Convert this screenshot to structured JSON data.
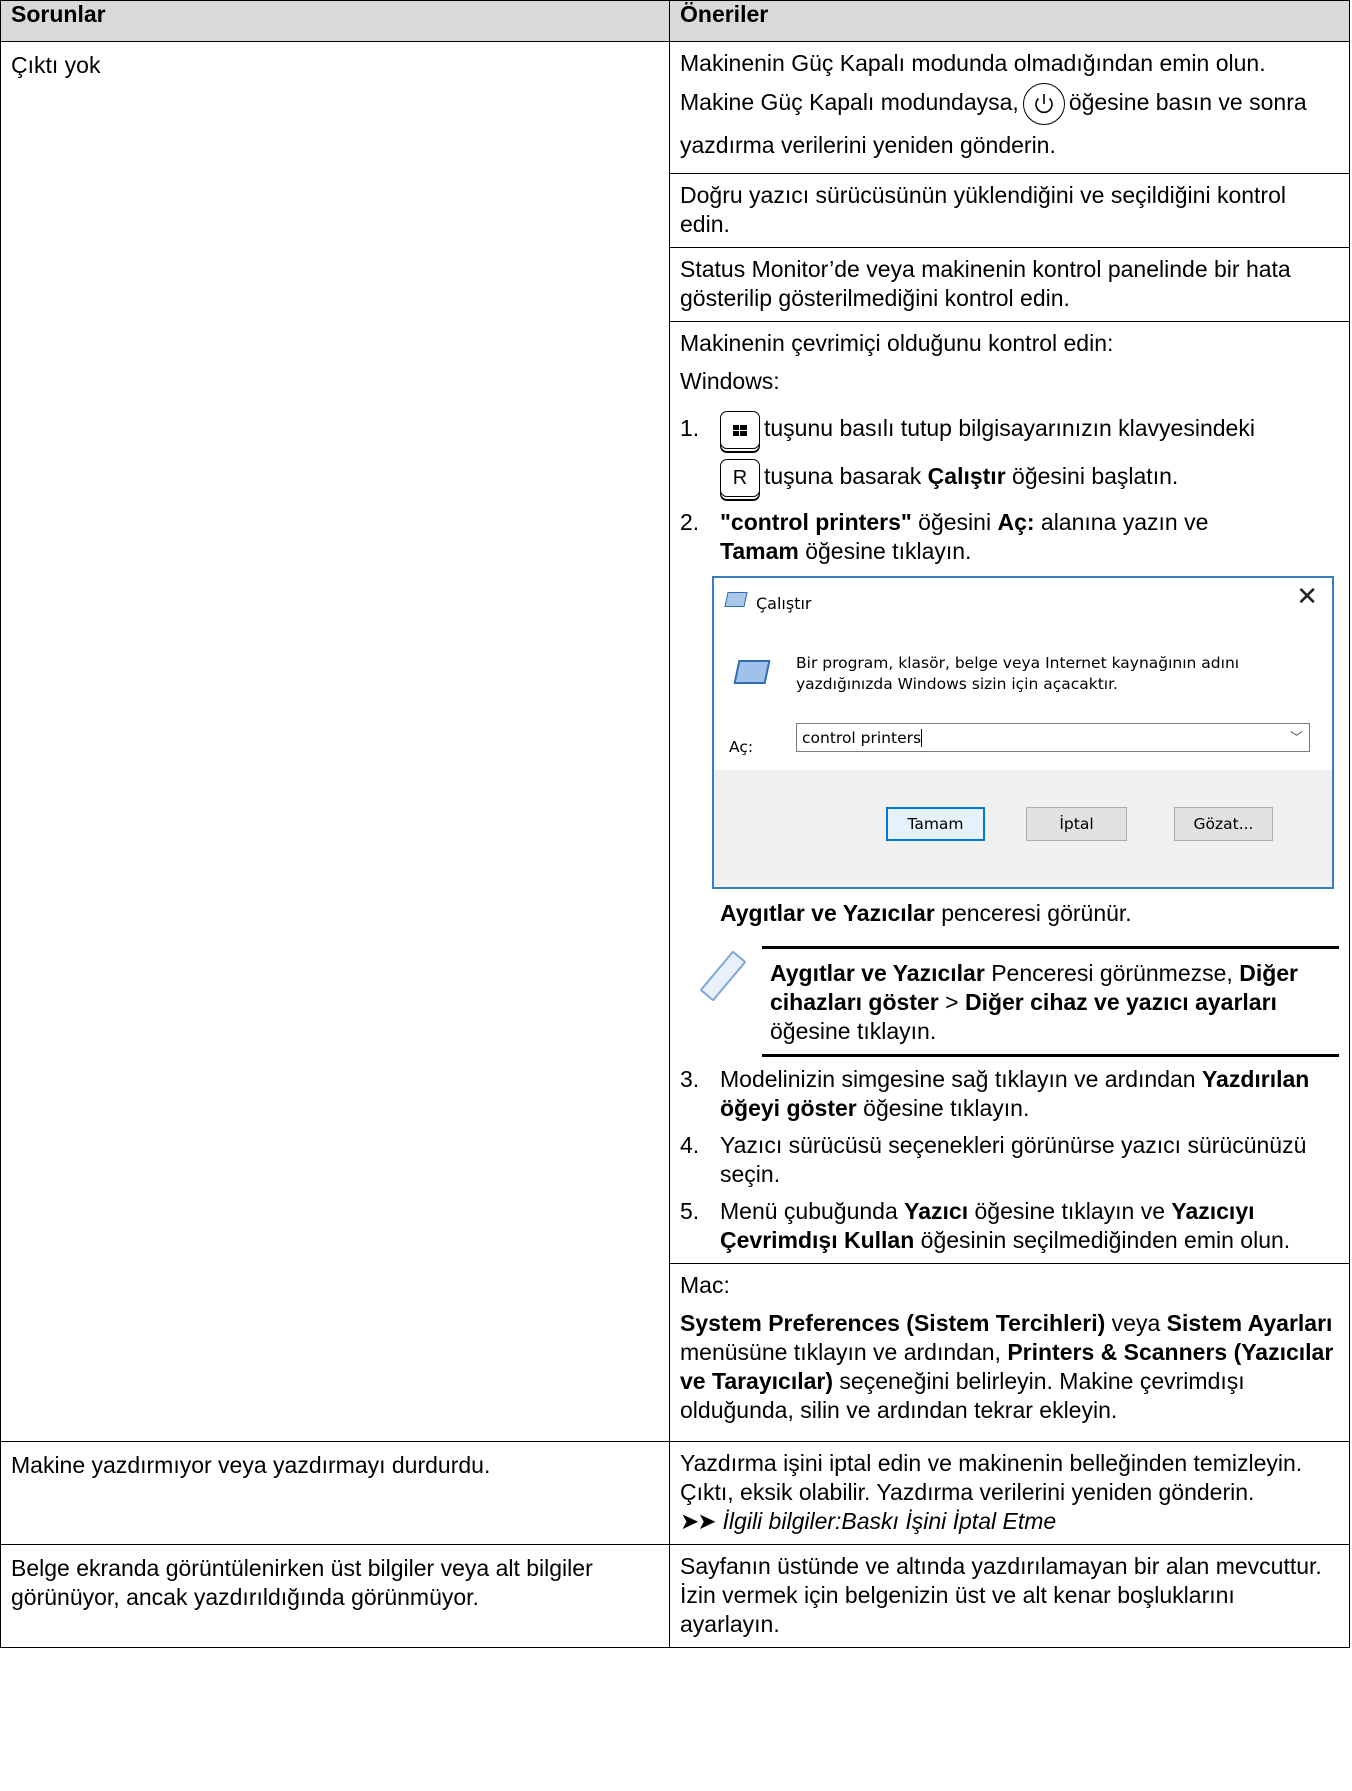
{
  "header": {
    "col_problems": "Sorunlar",
    "col_suggestions": "Öneriler"
  },
  "row1": {
    "problem": "Çıktı yok",
    "s1": "Makinenin Güç Kapalı modunda olmadığından emin olun.",
    "s2_a": "Makine Güç Kapalı modundaysa,",
    "s2_b": "öğesine basın ve sonra yazdırma verilerini yeniden gönderin.",
    "s3": "Doğru yazıcı sürücüsünün yüklendiğini ve seçildiğini kontrol edin.",
    "s4": "Status Monitor’de veya makinenin kontrol panelinde bir hata gösterilip gösterilmediğini kontrol edin.",
    "s5_intro": "Makinenin çevrimiçi olduğunu kontrol edin:",
    "s5_os": "Windows:",
    "step1_num": "1.",
    "step1_a": "tuşunu basılı tutup bilgisayarınızın klavyesindeki",
    "step1_key_r": "R",
    "step1_b": "tuşuna basarak",
    "step1_bold": "Çalıştır",
    "step1_c": "öğesini başlatın.",
    "step2_num": "2.",
    "step2_bold1": "\"control printers\"",
    "step2_a": "öğesini",
    "step2_bold2": "Aç:",
    "step2_b": "alanına yazın ve",
    "step2_bold3": "Tamam",
    "step2_c": "öğesine tıklayın.",
    "dialog": {
      "title": "Çalıştır",
      "desc_line1": "Bir program, klasör, belge veya Internet kaynağının adını",
      "desc_line2": "yazdığınızda Windows sizin için açacaktır.",
      "open_label": "Aç:",
      "input_value": "control printers",
      "ok": "Tamam",
      "cancel": "İptal",
      "browse": "Gözat..."
    },
    "after_dialog_bold": "Aygıtlar ve Yazıcılar",
    "after_dialog": "penceresi görünür.",
    "note_bold1": "Aygıtlar ve Yazıcılar",
    "note_a": "Penceresi görünmezse,",
    "note_bold2": "Diğer cihazları göster",
    "note_sep": ">",
    "note_bold3": "Diğer cihaz ve yazıcı ayarları",
    "note_b": "öğesine tıklayın.",
    "step3_num": "3.",
    "step3_a": "Modelinizin simgesine sağ tıklayın ve ardından",
    "step3_bold": "Yazdırılan öğeyi göster",
    "step3_b": "öğesine tıklayın.",
    "step4_num": "4.",
    "step4": "Yazıcı sürücüsü seçenekleri görünürse yazıcı sürücünüzü seçin.",
    "step5_num": "5.",
    "step5_a": "Menü çubuğunda",
    "step5_bold1": "Yazıcı",
    "step5_b": "öğesine tıklayın ve",
    "step5_bold2": "Yazıcıyı Çevrimdışı Kullan",
    "step5_c": "öğesinin seçilmediğinden emin olun.",
    "mac_label": "Mac:",
    "mac_bold1": "System Preferences (Sistem Tercihleri)",
    "mac_a": "veya",
    "mac_bold2": "Sistem Ayarları",
    "mac_b": "menüsüne tıklayın ve ardından,",
    "mac_bold3": "Printers & Scanners (Yazıcılar ve Tarayıcılar)",
    "mac_c": "seçeneğini belirleyin. Makine çevrimdışı olduğunda, silin ve ardından tekrar ekleyin."
  },
  "row2": {
    "problem": "Makine yazdırmıyor veya yazdırmayı durdurdu.",
    "suggestion": "Yazdırma işini iptal edin ve makinenin belleğinden temizleyin. Çıktı, eksik olabilir. Yazdırma verilerini yeniden gönderin.",
    "related_arrows": "➤➤",
    "related": "İlgili bilgiler:Baskı İşini İptal Etme"
  },
  "row3": {
    "problem": "Belge ekranda görüntülenirken üst bilgiler veya alt bilgiler görünüyor, ancak yazdırıldığında görünmüyor.",
    "suggestion": "Sayfanın üstünde ve altında yazdırılamayan bir alan mevcuttur. İzin vermek için belgenizin üst ve alt kenar boşluklarını ayarlayın."
  }
}
